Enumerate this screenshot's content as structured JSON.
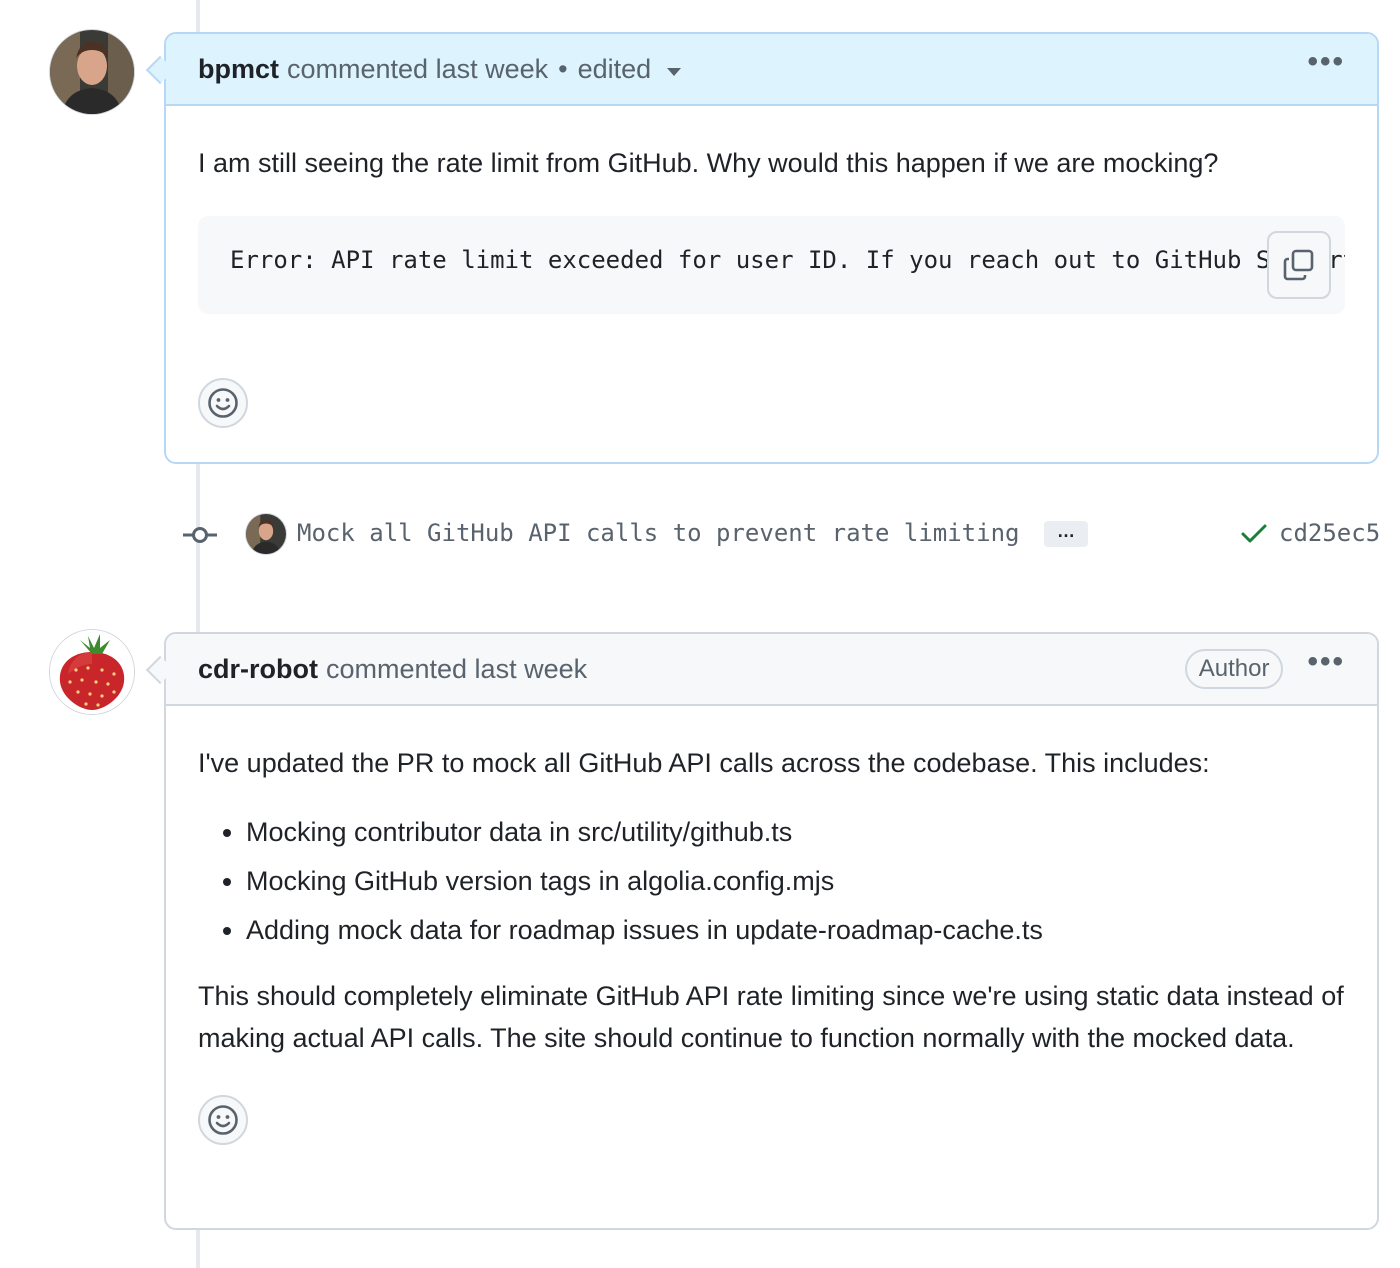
{
  "comments": [
    {
      "author": "bpmct",
      "meta": "commented last week",
      "separator": "•",
      "edited": "edited",
      "body": "I am still seeing the rate limit from GitHub. Why would this happen if we are mocking?",
      "code": "Error: API rate limit exceeded for user ID. If you reach out to GitHub Support"
    },
    {
      "author": "cdr-robot",
      "meta": "commented last week",
      "badge": "Author",
      "intro": "I've updated the PR to mock all GitHub API calls across the codebase. This includes:",
      "bullets": [
        "Mocking contributor data in src/utility/github.ts",
        "Mocking GitHub version tags in algolia.config.mjs",
        "Adding mock data for roadmap issues in update-roadmap-cache.ts"
      ],
      "outro": "This should completely eliminate GitHub API rate limiting since we're using static data instead of making actual API calls. The site should continue to function normally with the mocked data."
    }
  ],
  "commit": {
    "message": "Mock all GitHub API calls to prevent rate limiting",
    "ellipsis": "…",
    "sha": "cd25ec5"
  },
  "icons": {
    "kebab": "kebab-horizontal-icon",
    "copy": "copy-icon",
    "smiley": "smiley-icon",
    "commit": "git-commit-icon",
    "check": "check-icon"
  },
  "colors": {
    "highlight_header": "#ddf4ff",
    "highlight_border": "#b6d8f5",
    "check_green": "#1a7f37",
    "muted_text": "#59636e"
  },
  "kebab_glyph": "•••"
}
